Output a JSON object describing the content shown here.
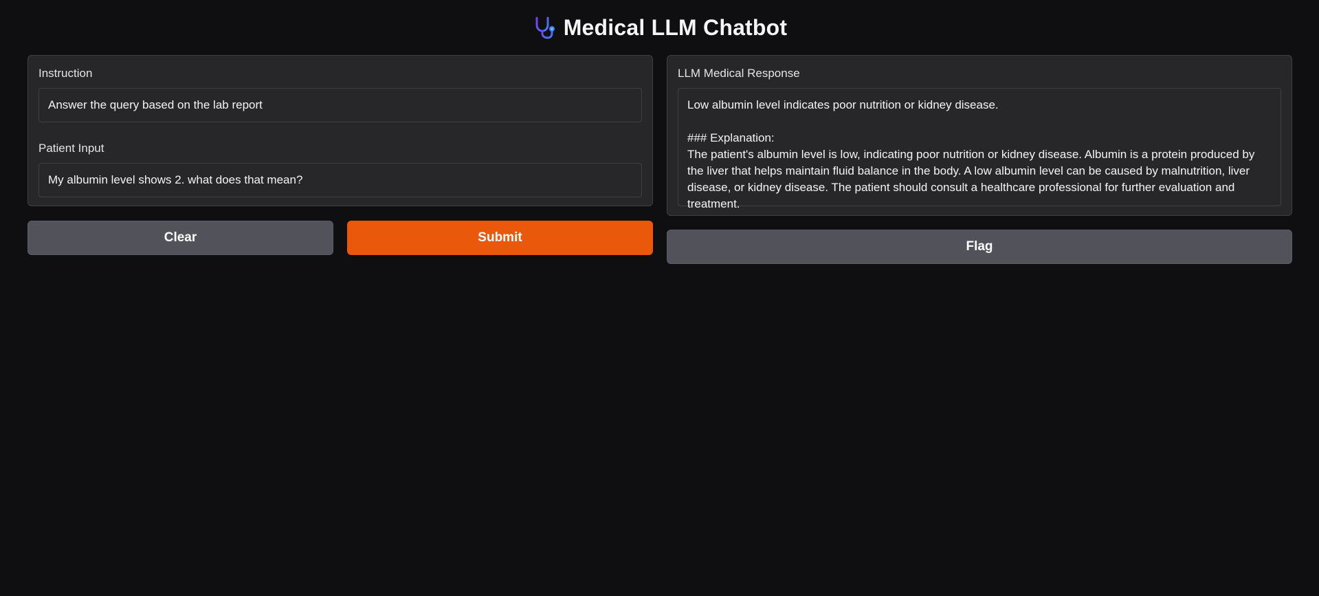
{
  "header": {
    "title": "Medical LLM Chatbot",
    "icon": "stethoscope-icon"
  },
  "inputs": {
    "instruction_label": "Instruction",
    "instruction_value": "Answer the query based on the lab report",
    "patient_label": "Patient Input",
    "patient_value": "My albumin level shows 2. what does that mean?"
  },
  "output": {
    "label": "LLM Medical Response",
    "value": "Low albumin level indicates poor nutrition or kidney disease.\n\n### Explanation:\nThe patient's albumin level is low, indicating poor nutrition or kidney disease. Albumin is a protein produced by the liver that helps maintain fluid balance in the body. A low albumin level can be caused by malnutrition, liver disease, or kidney disease. The patient should consult a healthcare professional for further evaluation and treatment."
  },
  "buttons": {
    "clear_label": "Clear",
    "submit_label": "Submit",
    "flag_label": "Flag"
  },
  "colors": {
    "background": "#0f0f11",
    "panel": "#27272a",
    "accent": "#ea580c",
    "secondary_button": "#52525b"
  }
}
